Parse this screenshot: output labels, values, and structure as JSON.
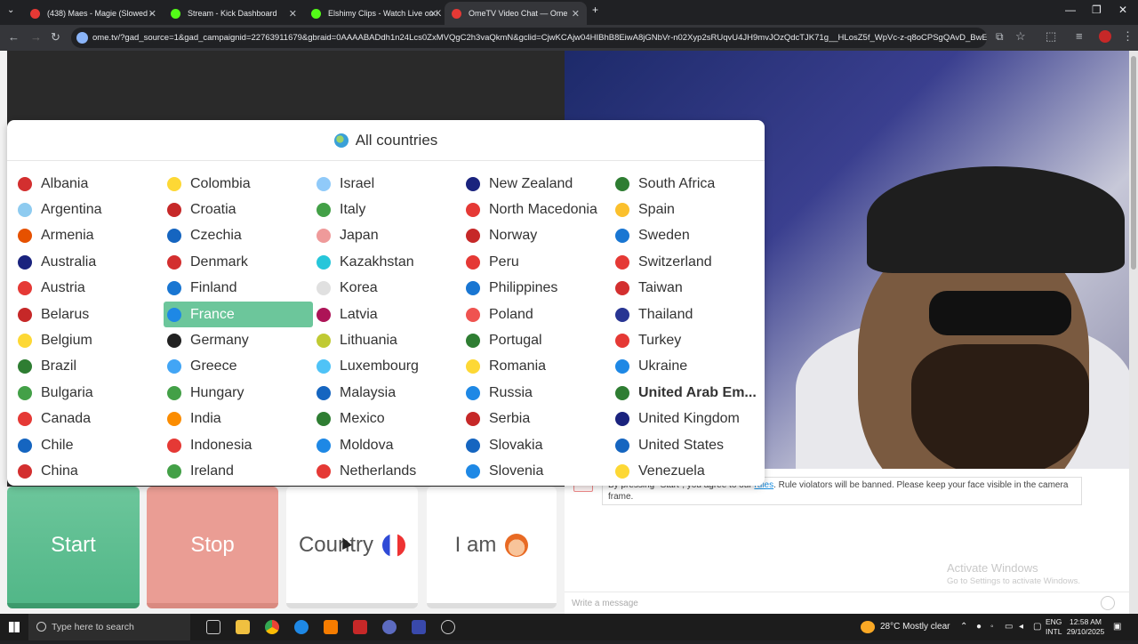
{
  "browser": {
    "tabs": [
      {
        "title": "(438) Maes - Magie (Slowed -",
        "color": "#e53935"
      },
      {
        "title": "Stream - Kick Dashboard",
        "color": "#53fc18"
      },
      {
        "title": "Elshimy Clips - Watch Live on K",
        "color": "#53fc18"
      },
      {
        "title": "OmeTV Video Chat — Ome",
        "color": "#e53935"
      }
    ],
    "url": "ome.tv/?gad_source=1&gad_campaignid=22763911679&gbraid=0AAAABADdh1n24Lcs0ZxMVQgC2h3vaQkmN&gclid=CjwKCAjw04HIBhB8EiwA8jGNbVr-n02Xyp2sRUqvU4JH9mvJOzQdcTJK71g__HLosZ5f_WpVc-z-q8oCPSgQAvD_BwE"
  },
  "dropdown": {
    "header": "All countries",
    "columns": [
      [
        {
          "name": "Albania",
          "color": "#d32f2f"
        },
        {
          "name": "Argentina",
          "color": "#8ecbf0"
        },
        {
          "name": "Armenia",
          "color": "#e65100"
        },
        {
          "name": "Australia",
          "color": "#1a237e"
        },
        {
          "name": "Austria",
          "color": "#e53935"
        },
        {
          "name": "Belarus",
          "color": "#c62828"
        },
        {
          "name": "Belgium",
          "color": "#fdd835"
        },
        {
          "name": "Brazil",
          "color": "#2e7d32"
        },
        {
          "name": "Bulgaria",
          "color": "#43a047"
        },
        {
          "name": "Canada",
          "color": "#e53935"
        },
        {
          "name": "Chile",
          "color": "#1565c0"
        },
        {
          "name": "China",
          "color": "#d32f2f"
        }
      ],
      [
        {
          "name": "Colombia",
          "color": "#fdd835"
        },
        {
          "name": "Croatia",
          "color": "#c62828"
        },
        {
          "name": "Czechia",
          "color": "#1565c0"
        },
        {
          "name": "Denmark",
          "color": "#d32f2f"
        },
        {
          "name": "Finland",
          "color": "#1976d2"
        },
        {
          "name": "France",
          "color": "#1e88e5",
          "selected": true
        },
        {
          "name": "Germany",
          "color": "#212121"
        },
        {
          "name": "Greece",
          "color": "#42a5f5"
        },
        {
          "name": "Hungary",
          "color": "#43a047"
        },
        {
          "name": "India",
          "color": "#fb8c00"
        },
        {
          "name": "Indonesia",
          "color": "#e53935"
        },
        {
          "name": "Ireland",
          "color": "#43a047"
        }
      ],
      [
        {
          "name": "Israel",
          "color": "#90caf9"
        },
        {
          "name": "Italy",
          "color": "#43a047"
        },
        {
          "name": "Japan",
          "color": "#ef9a9a"
        },
        {
          "name": "Kazakhstan",
          "color": "#26c6da"
        },
        {
          "name": "Korea",
          "color": "#e0e0e0"
        },
        {
          "name": "Latvia",
          "color": "#ad1457"
        },
        {
          "name": "Lithuania",
          "color": "#c0ca33"
        },
        {
          "name": "Luxembourg",
          "color": "#4fc3f7"
        },
        {
          "name": "Malaysia",
          "color": "#1565c0"
        },
        {
          "name": "Mexico",
          "color": "#2e7d32"
        },
        {
          "name": "Moldova",
          "color": "#1e88e5"
        },
        {
          "name": "Netherlands",
          "color": "#e53935"
        }
      ],
      [
        {
          "name": "New Zealand",
          "color": "#1a237e"
        },
        {
          "name": "North Macedonia",
          "color": "#e53935"
        },
        {
          "name": "Norway",
          "color": "#c62828"
        },
        {
          "name": "Peru",
          "color": "#e53935"
        },
        {
          "name": "Philippines",
          "color": "#1976d2"
        },
        {
          "name": "Poland",
          "color": "#ef5350"
        },
        {
          "name": "Portugal",
          "color": "#2e7d32"
        },
        {
          "name": "Romania",
          "color": "#fdd835"
        },
        {
          "name": "Russia",
          "color": "#1e88e5"
        },
        {
          "name": "Serbia",
          "color": "#c62828"
        },
        {
          "name": "Slovakia",
          "color": "#1565c0"
        },
        {
          "name": "Slovenia",
          "color": "#1e88e5"
        }
      ],
      [
        {
          "name": "South Africa",
          "color": "#2e7d32"
        },
        {
          "name": "Spain",
          "color": "#fbc02d"
        },
        {
          "name": "Sweden",
          "color": "#1976d2"
        },
        {
          "name": "Switzerland",
          "color": "#e53935"
        },
        {
          "name": "Taiwan",
          "color": "#d32f2f"
        },
        {
          "name": "Thailand",
          "color": "#283593"
        },
        {
          "name": "Turkey",
          "color": "#e53935"
        },
        {
          "name": "Ukraine",
          "color": "#1e88e5"
        },
        {
          "name": "United Arab Em...",
          "color": "#2e7d32",
          "bold": true
        },
        {
          "name": "United Kingdom",
          "color": "#1a237e"
        },
        {
          "name": "United States",
          "color": "#1565c0"
        },
        {
          "name": "Venezuela",
          "color": "#fdd835"
        }
      ]
    ]
  },
  "buttons": {
    "start": "Start",
    "stop": "Stop",
    "country": "Country",
    "iam": "I am"
  },
  "chat": {
    "notice_prefix": "By pressing \"Start\", you agree to our ",
    "notice_link": "rules",
    "notice_suffix": ". Rule violators will be banned. Please keep your face visible in the camera frame.",
    "watermark_title": "Activate Windows",
    "watermark_sub": "Go to Settings to activate Windows.",
    "input_placeholder": "Write a message"
  },
  "taskbar": {
    "search_placeholder": "Type here to search",
    "weather": "28°C  Mostly clear",
    "lang": "ENG",
    "lang_sub": "INTL",
    "time": "12:58 AM",
    "date": "29/10/2025"
  }
}
